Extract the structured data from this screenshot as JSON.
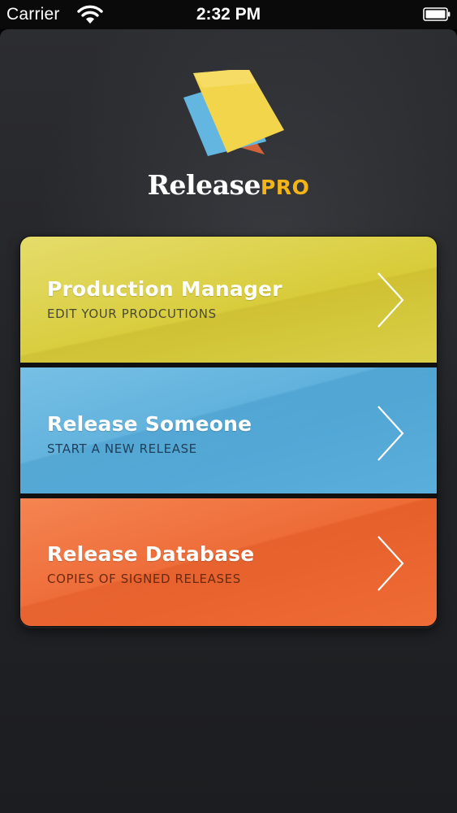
{
  "status_bar": {
    "carrier": "Carrier",
    "time": "2:32 PM"
  },
  "app": {
    "name_part1": "Release",
    "name_part2": "PRO"
  },
  "icons": {
    "logo": "stacked-papers-logo-icon",
    "wifi": "wifi-icon",
    "battery": "battery-icon",
    "chevron": "chevron-right-icon"
  },
  "menu": {
    "items": [
      {
        "title": "Production Manager",
        "subtitle": "EDIT YOUR PRODCUTIONS",
        "color": "#d9cc3c",
        "subtitle_color": "#4a4a34"
      },
      {
        "title": "Release Someone",
        "subtitle": "START A NEW RELEASE",
        "color": "#5db0dc",
        "subtitle_color": "#1f3f5a"
      },
      {
        "title": "Release Database",
        "subtitle": "COPIES OF SIGNED RELEASES",
        "color": "#ef6a35",
        "subtitle_color": "#6a2a12"
      }
    ]
  },
  "colors": {
    "background": "#25262a",
    "brand_accent": "#f2b416",
    "logo_yellow": "#f3d54c",
    "logo_blue": "#62b6e0",
    "logo_orange": "#d2623a"
  }
}
